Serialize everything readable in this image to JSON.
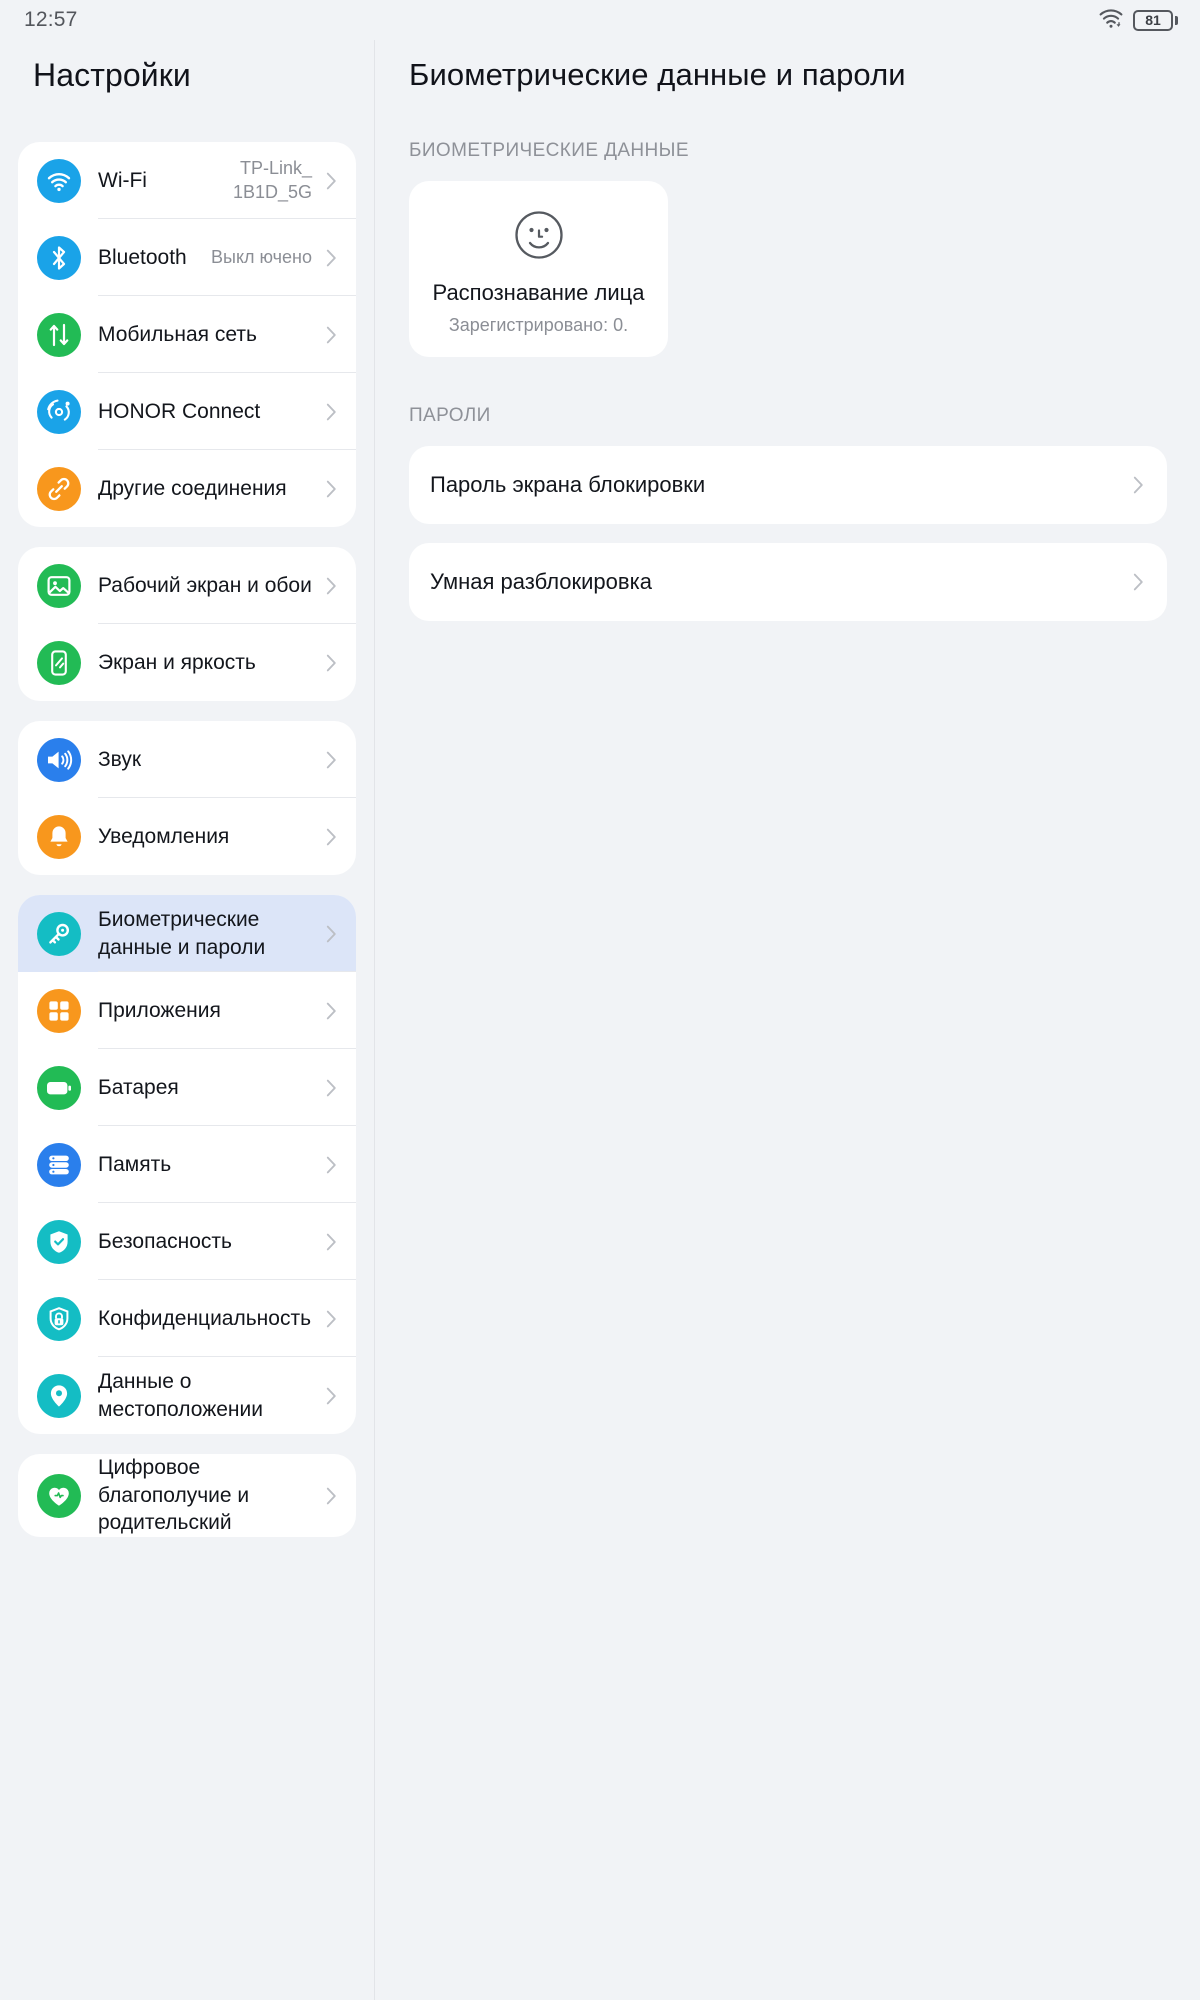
{
  "status_bar": {
    "time": "12:57",
    "battery_percent": "81",
    "wifi_icon": "wifi-icon",
    "battery_icon": "battery-icon"
  },
  "colors": {
    "page_bg": "#f1f3f6",
    "card_bg": "#ffffff",
    "selected_row_bg": "#dce5f8",
    "blue": "#1aa3e8",
    "green": "#22bb55",
    "orange": "#f8971d",
    "teal": "#14bdc4",
    "blue_dark": "#2a7fec",
    "text": "#13161c",
    "muted": "#8b8e95"
  },
  "sidebar": {
    "title": "Настройки",
    "groups": [
      {
        "items": [
          {
            "label": "Wi-Fi",
            "value": "TP-Link_ 1B1D_5G",
            "icon": "wifi-icon",
            "color": "#1aa3e8",
            "selected": false
          },
          {
            "label": "Bluetooth",
            "value": "Выкл ючено",
            "icon": "bluetooth-icon",
            "color": "#1aa3e8",
            "selected": false
          },
          {
            "label": "Мобильная сеть",
            "value": "",
            "icon": "mobile-network-icon",
            "color": "#22bb55",
            "selected": false
          },
          {
            "label": "HONOR Connect",
            "value": "",
            "icon": "honor-connect-icon",
            "color": "#1aa3e8",
            "selected": false
          },
          {
            "label": "Другие соединения",
            "value": "",
            "icon": "link-icon",
            "color": "#f8971d",
            "selected": false
          }
        ]
      },
      {
        "items": [
          {
            "label": "Рабочий экран и обои",
            "value": "",
            "icon": "wallpaper-icon",
            "color": "#22bb55",
            "selected": false
          },
          {
            "label": "Экран и яркость",
            "value": "",
            "icon": "brightness-icon",
            "color": "#22bb55",
            "selected": false
          }
        ]
      },
      {
        "items": [
          {
            "label": "Звук",
            "value": "",
            "icon": "sound-icon",
            "color": "#2a7fec",
            "selected": false
          },
          {
            "label": "Уведомления",
            "value": "",
            "icon": "bell-icon",
            "color": "#f8971d",
            "selected": false
          }
        ]
      },
      {
        "items": [
          {
            "label": "Биометрические данные и пароли",
            "value": "",
            "icon": "key-icon",
            "color": "#14bdc4",
            "selected": true
          },
          {
            "label": "Приложения",
            "value": "",
            "icon": "apps-icon",
            "color": "#f8971d",
            "selected": false
          },
          {
            "label": "Батарея",
            "value": "",
            "icon": "battery-icon",
            "color": "#22bb55",
            "selected": false
          },
          {
            "label": "Память",
            "value": "",
            "icon": "storage-icon",
            "color": "#2a7fec",
            "selected": false
          },
          {
            "label": "Безопасность",
            "value": "",
            "icon": "shield-check-icon",
            "color": "#14bdc4",
            "selected": false
          },
          {
            "label": "Конфиденциальность",
            "value": "",
            "icon": "privacy-lock-icon",
            "color": "#14bdc4",
            "selected": false
          },
          {
            "label": "Данные о местоположении",
            "value": "",
            "icon": "location-pin-icon",
            "color": "#14bdc4",
            "selected": false
          }
        ]
      },
      {
        "items": [
          {
            "label": "Цифровое благополучие и родительский",
            "value": "",
            "icon": "digital-wellbeing-icon",
            "color": "#22bb55",
            "selected": false
          }
        ]
      }
    ]
  },
  "main": {
    "title": "Биометрические данные и пароли",
    "biometrics_section": {
      "header": "БИОМЕТРИЧЕСКИЕ ДАННЫЕ",
      "card": {
        "icon": "face-smiley-icon",
        "name": "Распознавание лица",
        "subtitle": "Зарегистрировано: 0."
      }
    },
    "passwords_section": {
      "header": "ПАРОЛИ",
      "items": [
        {
          "label": "Пароль экрана блокировки"
        },
        {
          "label": "Умная разблокировка"
        }
      ]
    }
  }
}
